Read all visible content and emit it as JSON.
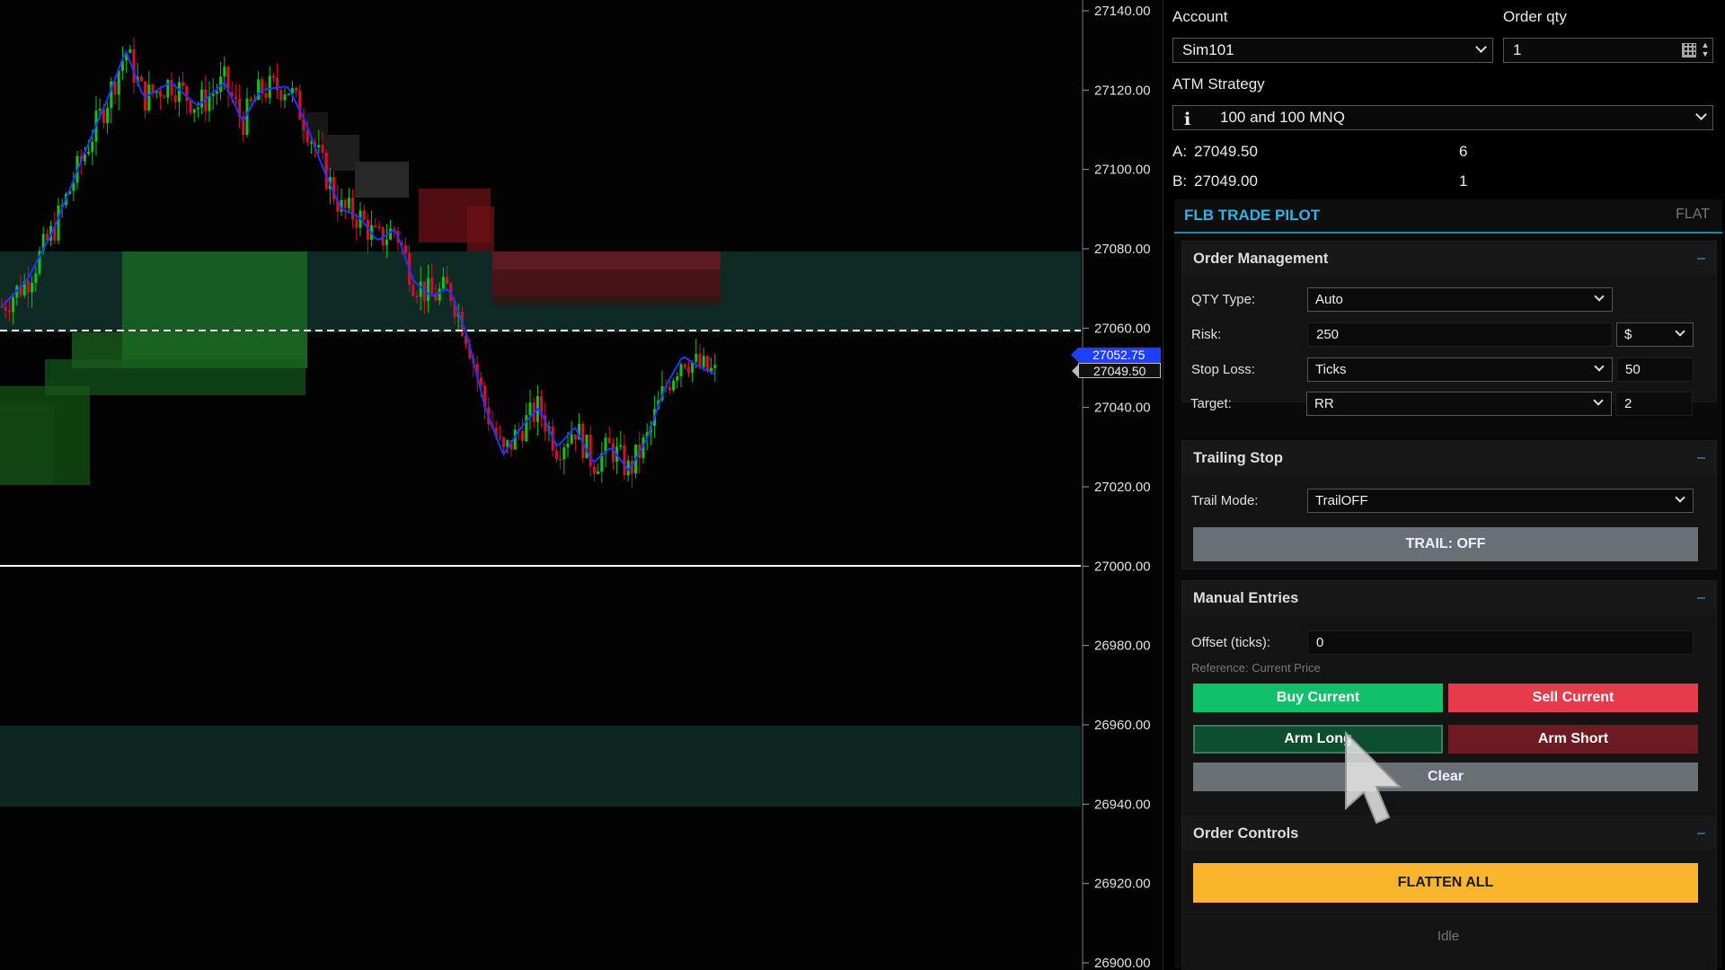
{
  "chart": {
    "price_axis_labels": [
      "27140.00",
      "27120.00",
      "27100.00",
      "27080.00",
      "27060.00",
      "27040.00",
      "27020.00",
      "27000.00",
      "26980.00",
      "26960.00",
      "26940.00",
      "26920.00",
      "26900.00"
    ],
    "ask_tag": "27052.75",
    "last_tag": "27049.50",
    "colors": {
      "up": "#12c21a",
      "down": "#d0122c",
      "ma": "#2233ff",
      "bg": "#030303"
    }
  },
  "panel": {
    "account_label": "Account",
    "account_value": "Sim101",
    "order_qty_label": "Order qty",
    "order_qty_value": "1",
    "atm_label": "ATM Strategy",
    "atm_value": "100 and 100 MNQ",
    "atm_icon": "info-icon",
    "ask_label": "A:",
    "ask_price": "27049.50",
    "ask_size": "6",
    "bid_label": "B:",
    "bid_price": "27049.00",
    "bid_size": "1"
  },
  "pilot": {
    "title": "FLB TRADE PILOT",
    "state": "FLAT",
    "collapse_glyph": "–",
    "order_management": {
      "title": "Order Management",
      "qty_type_label": "QTY Type:",
      "qty_type_value": "Auto",
      "risk_label": "Risk:",
      "risk_value": "250",
      "risk_unit": "$",
      "stop_loss_label": "Stop Loss:",
      "stop_loss_value": "Ticks",
      "stop_loss_amount": "50",
      "target_label": "Target:",
      "target_value": "RR",
      "target_amount": "2"
    },
    "trailing_stop": {
      "title": "Trailing Stop",
      "trail_mode_label": "Trail Mode:",
      "trail_mode_value": "TrailOFF",
      "trail_button": "TRAIL: OFF"
    },
    "manual_entries": {
      "title": "Manual Entries",
      "offset_label": "Offset (ticks):",
      "offset_value": "0",
      "reference_note": "Reference: Current Price",
      "buy_current": "Buy Current",
      "sell_current": "Sell Current",
      "arm_long": "Arm Long",
      "arm_short": "Arm Short",
      "clear": "Clear"
    },
    "order_controls": {
      "title": "Order Controls",
      "flatten_all": "FLATTEN ALL"
    },
    "status": "Idle"
  }
}
